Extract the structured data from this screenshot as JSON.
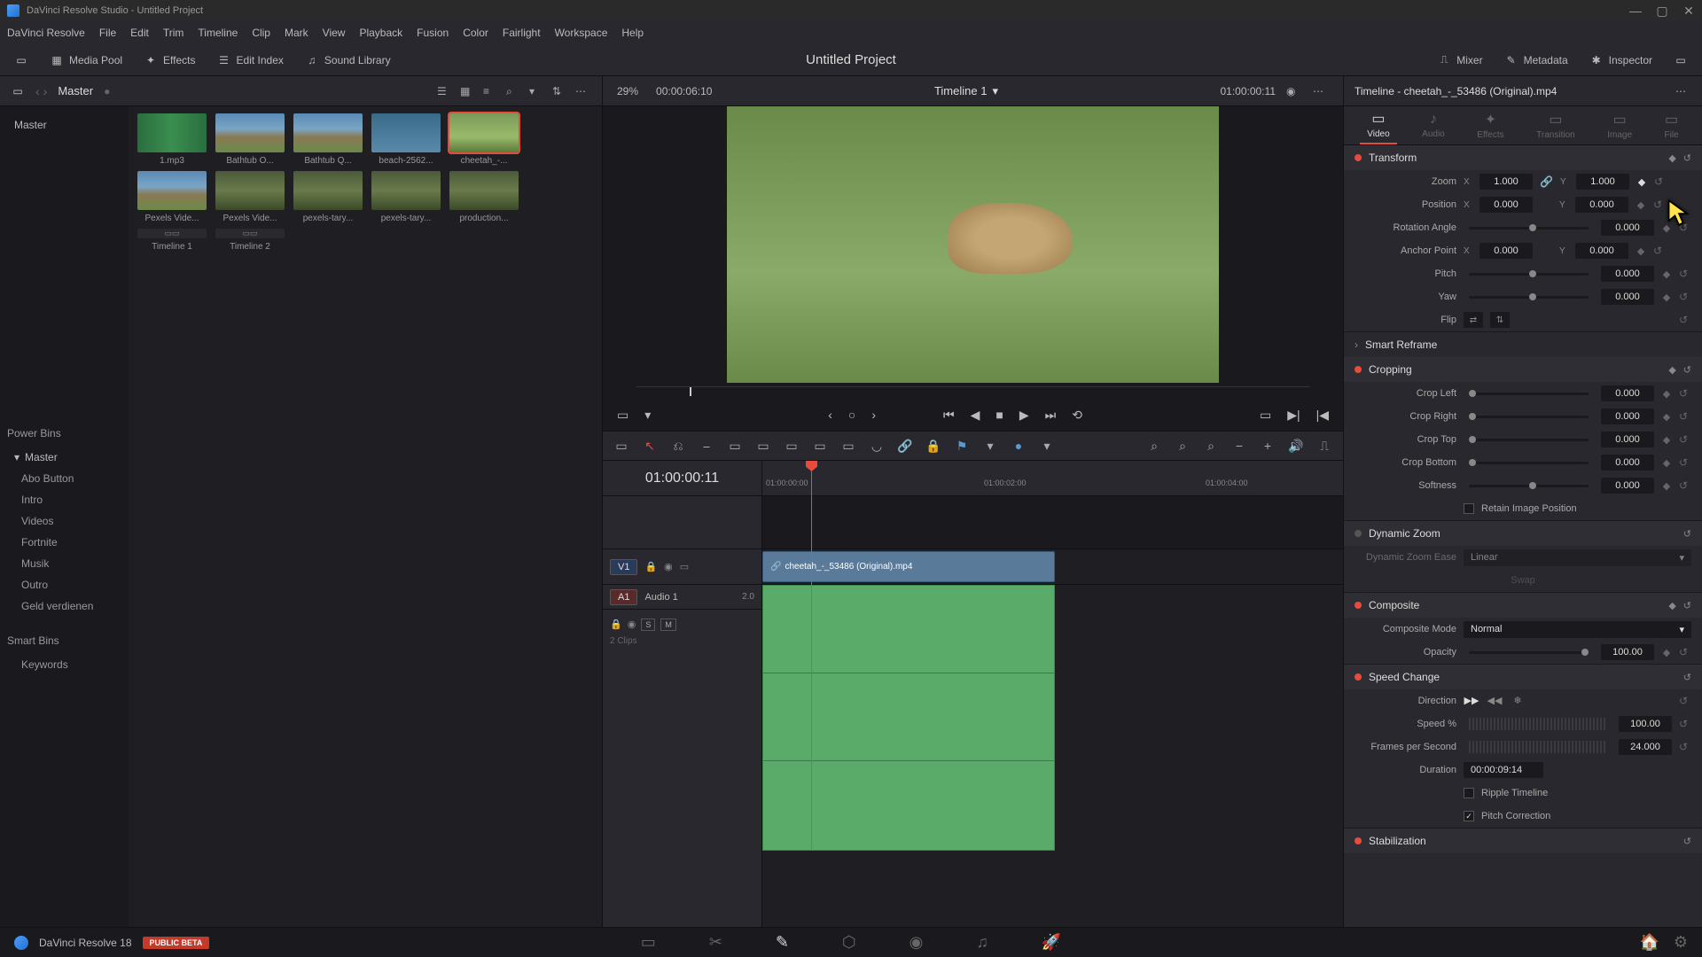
{
  "titlebar": {
    "title": "DaVinci Resolve Studio - Untitled Project"
  },
  "menubar": [
    "DaVinci Resolve",
    "File",
    "Edit",
    "Trim",
    "Timeline",
    "Clip",
    "Mark",
    "View",
    "Playback",
    "Fusion",
    "Color",
    "Fairlight",
    "Workspace",
    "Help"
  ],
  "toolbar": {
    "left": [
      {
        "icon": "media-pool",
        "label": "Media Pool"
      },
      {
        "icon": "effects",
        "label": "Effects"
      },
      {
        "icon": "edit-index",
        "label": "Edit Index"
      },
      {
        "icon": "sound-library",
        "label": "Sound Library"
      }
    ],
    "project_title": "Untitled Project",
    "right": [
      {
        "icon": "mixer",
        "label": "Mixer"
      },
      {
        "icon": "metadata",
        "label": "Metadata"
      },
      {
        "icon": "inspector",
        "label": "Inspector"
      }
    ]
  },
  "media": {
    "master_label": "Master",
    "tree_master": "Master",
    "power_bins": "Power Bins",
    "power_master": "Master",
    "power_items": [
      "Abo Button",
      "Intro",
      "Videos",
      "Fortnite",
      "Musik",
      "Outro",
      "Geld verdienen"
    ],
    "smart_bins": "Smart Bins",
    "smart_items": [
      "Keywords"
    ],
    "thumbs": [
      {
        "label": "1.mp3",
        "kind": "audio"
      },
      {
        "label": "Bathtub O...",
        "kind": "landscape"
      },
      {
        "label": "Bathtub Q...",
        "kind": "landscape"
      },
      {
        "label": "beach-2562...",
        "kind": "water"
      },
      {
        "label": "cheetah_-...",
        "kind": "cheetah",
        "selected": true
      },
      {
        "label": "Pexels Vide...",
        "kind": "landscape"
      },
      {
        "label": "Pexels Vide...",
        "kind": "forest"
      },
      {
        "label": "pexels-tary...",
        "kind": "forest"
      },
      {
        "label": "pexels-tary...",
        "kind": "forest"
      },
      {
        "label": "production...",
        "kind": "forest"
      },
      {
        "label": "Timeline 1",
        "kind": "timeline"
      },
      {
        "label": "Timeline 2",
        "kind": "timeline"
      }
    ]
  },
  "viewer": {
    "zoom": "29%",
    "duration": "00:00:06:10",
    "title": "Timeline 1",
    "timecode": "01:00:00:11"
  },
  "timeline": {
    "timecode": "01:00:00:11",
    "ruler": [
      "01:00:00:00",
      "01:00:02:00",
      "01:00:04:00"
    ],
    "v1": "V1",
    "a1": "A1",
    "audio_name": "Audio 1",
    "audio_gain": "2.0",
    "clips_count": "2 Clips",
    "video_clip": "cheetah_-_53486 (Original).mp4"
  },
  "inspector": {
    "title": "Timeline - cheetah_-_53486 (Original).mp4",
    "tabs": [
      {
        "label": "Video",
        "icon": "▭",
        "active": true
      },
      {
        "label": "Audio",
        "icon": "♪"
      },
      {
        "label": "Effects",
        "icon": "✦"
      },
      {
        "label": "Transition",
        "icon": "▭"
      },
      {
        "label": "Image",
        "icon": "▭"
      },
      {
        "label": "File",
        "icon": "▭"
      }
    ],
    "transform": {
      "title": "Transform",
      "zoom_label": "Zoom",
      "zoom_x": "1.000",
      "zoom_y": "1.000",
      "position_label": "Position",
      "pos_x": "0.000",
      "pos_y": "0.000",
      "rotation_label": "Rotation Angle",
      "rotation": "0.000",
      "anchor_label": "Anchor Point",
      "anchor_x": "0.000",
      "anchor_y": "0.000",
      "pitch_label": "Pitch",
      "pitch": "0.000",
      "yaw_label": "Yaw",
      "yaw": "0.000",
      "flip_label": "Flip"
    },
    "smart_reframe": "Smart Reframe",
    "cropping": {
      "title": "Cropping",
      "left_label": "Crop Left",
      "left": "0.000",
      "right_label": "Crop Right",
      "right": "0.000",
      "top_label": "Crop Top",
      "top": "0.000",
      "bottom_label": "Crop Bottom",
      "bottom": "0.000",
      "softness_label": "Softness",
      "softness": "0.000",
      "retain_label": "Retain Image Position"
    },
    "dynamic_zoom": {
      "title": "Dynamic Zoom",
      "ease_label": "Dynamic Zoom Ease",
      "ease_value": "Linear",
      "swap": "Swap"
    },
    "composite": {
      "title": "Composite",
      "mode_label": "Composite Mode",
      "mode": "Normal",
      "opacity_label": "Opacity",
      "opacity": "100.00"
    },
    "speed": {
      "title": "Speed Change",
      "direction_label": "Direction",
      "speed_label": "Speed %",
      "speed": "100.00",
      "fps_label": "Frames per Second",
      "fps": "24.000",
      "duration_label": "Duration",
      "duration": "00:00:09:14",
      "ripple_label": "Ripple Timeline",
      "pitch_label": "Pitch Correction"
    },
    "stabilization": "Stabilization"
  },
  "bottombar": {
    "label": "DaVinci Resolve 18",
    "beta": "PUBLIC BETA"
  }
}
